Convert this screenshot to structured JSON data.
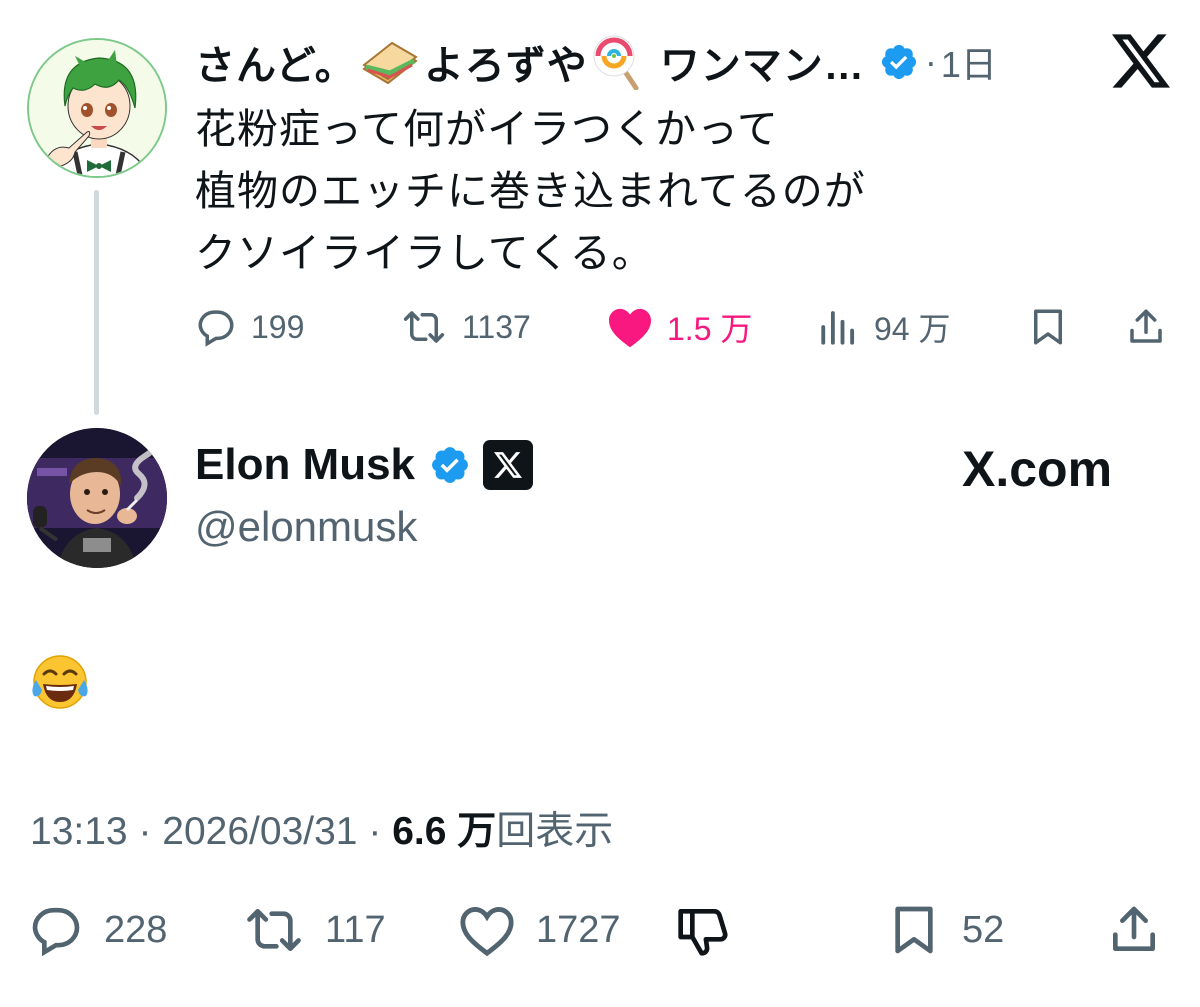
{
  "reply_parent": {
    "display_name": "さんど。",
    "display_name_mid": "よろずや",
    "display_name_tail": "ワンマン…",
    "time_sep": "·",
    "time": "1日",
    "body_lines": [
      "花粉症って何がイラつくかって",
      "植物のエッチに巻き込まれてるのが",
      "クソイライラしてくる。"
    ],
    "actions": {
      "replies": "199",
      "reposts": "1137",
      "likes": "1.5 万",
      "views": "94 万"
    },
    "colors": {
      "like_active": "#f91880",
      "muted": "#536471",
      "verified": "#1d9bf0"
    },
    "icons": [
      "sandwich-emoji",
      "lollipop-emoji",
      "verified-badge-icon",
      "x-logo-icon",
      "reply-icon",
      "repost-icon",
      "heart-filled-icon",
      "views-icon",
      "bookmark-icon",
      "share-icon"
    ]
  },
  "tweet": {
    "display_name": "Elon Musk",
    "handle": "@elonmusk",
    "affiliation": "X.com",
    "body_emoji": "face-with-tears-of-joy",
    "meta": {
      "time": "13:13",
      "sep1": "·",
      "date": "2026/03/31",
      "sep2": "·",
      "views_value": "6.6 万",
      "views_label": "回表示"
    },
    "actions": {
      "replies": "228",
      "reposts": "117",
      "likes": "1727",
      "bookmarks": "52"
    },
    "icons": [
      "verified-badge-icon",
      "x-affiliate-badge-icon",
      "reply-icon",
      "repost-icon",
      "heart-outline-icon",
      "dislike-icon",
      "bookmark-icon",
      "share-icon"
    ]
  }
}
